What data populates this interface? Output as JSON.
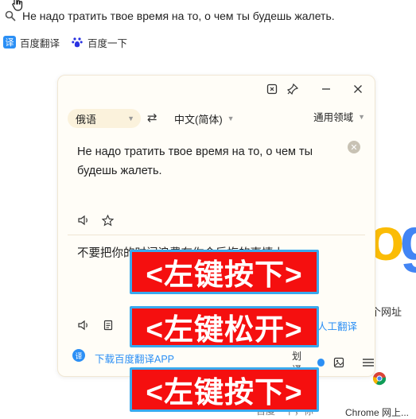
{
  "search": {
    "query": "Не надо тратить твое время на то, о чем ты будешь жалеть."
  },
  "shortcuts": {
    "fanyi_icon_text": "译",
    "fanyi_label": "百度翻译",
    "baidu_label": "百度一下"
  },
  "background": {
    "google_partial_o": "o",
    "google_partial_g": "g",
    "web_label": "个网址",
    "chrome_label": "Chrome 网上...",
    "baidu_label": "百度一下，你"
  },
  "translator": {
    "source_lang": "俄语",
    "target_lang": "中文(简体)",
    "domain": "通用领域",
    "source_text": "Не надо тратить твое время на то, о чем ты будешь жалеть.",
    "target_text": "不要把你的时间浪费在你会后悔的事情上。",
    "human_translation_link": "人工翻译",
    "footer_icon_text": "译",
    "footer_link": "下载百度翻译APP",
    "footer_toggle_label": "划译"
  },
  "overlays": {
    "first": "<左键按下>",
    "second": "<左键松开>",
    "third": "<左键按下>"
  },
  "colors": {
    "accent": "#2b8ff5",
    "overlay_bg": "#f50f0f",
    "overlay_border": "#39a9ee",
    "popup_bg": "#fffdf7",
    "lang_pill": "#fbf2dc"
  },
  "icons": {
    "cursor": "hand-cursor-icon",
    "search": "search-icon",
    "pin": "pin-icon",
    "screenshot": "screenshot-icon",
    "minimize": "minimize-icon",
    "close": "close-icon",
    "swap": "swap-icon",
    "speaker": "speaker-icon",
    "star": "star-icon",
    "copy": "copy-icon",
    "image": "image-icon",
    "menu": "menu-icon"
  }
}
